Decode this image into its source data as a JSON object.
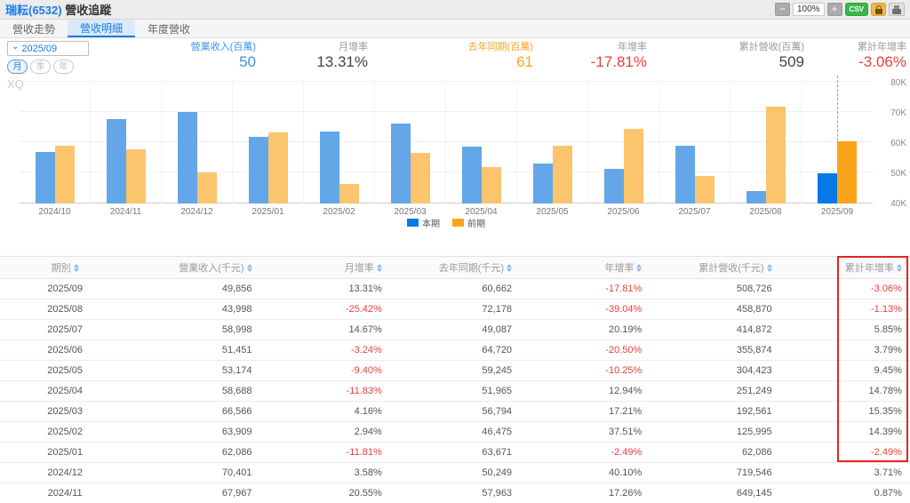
{
  "header": {
    "stock": "瑞耘(6532)",
    "title": "營收追蹤",
    "zoom_out": "−",
    "zoom_level": "100%",
    "zoom_in": "+",
    "csv": "CSV"
  },
  "tabs": [
    {
      "label": "營收走勢",
      "active": false
    },
    {
      "label": "營收明細",
      "active": true
    },
    {
      "label": "年度營收",
      "active": false
    }
  ],
  "controls": {
    "date": "2025/09",
    "period_buttons": [
      {
        "label": "月",
        "active": true
      },
      {
        "label": "季",
        "active": false
      },
      {
        "label": "年",
        "active": false
      }
    ]
  },
  "stats": [
    {
      "label": "營業收入(百萬)",
      "value": "50",
      "label_color": "#3c94ea",
      "value_color": "#3c94ea"
    },
    {
      "label": "月增率",
      "value": "13.31%",
      "label_color": "#999999",
      "value_color": "#444444"
    },
    {
      "label": "去年同期(百萬)",
      "value": "61",
      "label_color": "#f5a623",
      "value_color": "#f5a623"
    },
    {
      "label": "年增率",
      "value": "-17.81%",
      "label_color": "#999999",
      "value_color": "#e8403a"
    },
    {
      "label": "累計營收(百萬)",
      "value": "509",
      "label_color": "#999999",
      "value_color": "#444444"
    },
    {
      "label": "累計年增率",
      "value": "-3.06%",
      "label_color": "#999999",
      "value_color": "#e8403a"
    }
  ],
  "chart_data": {
    "type": "bar",
    "watermark": "XQ",
    "categories": [
      "2024/10",
      "2024/11",
      "2024/12",
      "2025/01",
      "2025/02",
      "2025/03",
      "2025/04",
      "2025/05",
      "2025/06",
      "2025/07",
      "2025/08",
      "2025/09"
    ],
    "series": [
      {
        "name": "本期",
        "color": "#63a7e8",
        "highlight_color": "#0878e8",
        "values": [
          57.0,
          67.97,
          70.4,
          62.09,
          63.91,
          66.57,
          58.69,
          53.17,
          51.45,
          59.0,
          44.0,
          49.86
        ]
      },
      {
        "name": "前期",
        "color": "#fbc46d",
        "highlight_color": "#faa41b",
        "values": [
          59.0,
          57.96,
          50.25,
          63.67,
          46.48,
          56.79,
          51.97,
          59.25,
          64.72,
          49.09,
          72.18,
          60.66
        ]
      }
    ],
    "unit": "千元 (thousands, axis in K)",
    "ylim": [
      40,
      82
    ],
    "yticks": [
      "80K",
      "70K",
      "60K",
      "50K",
      "40K"
    ],
    "highlight_index": 11,
    "legend": [
      "本期",
      "前期"
    ],
    "legend_position": "bottom-center",
    "grid": true
  },
  "table": {
    "columns": [
      "期別",
      "營業收入(千元)",
      "月增率",
      "去年同期(千元)",
      "年增率",
      "累計營收(千元)",
      "累計年增率"
    ],
    "rows": [
      [
        "2025/09",
        "49,856",
        "13.31%",
        "60,662",
        "-17.81%",
        "508,726",
        "-3.06%"
      ],
      [
        "2025/08",
        "43,998",
        "-25.42%",
        "72,178",
        "-39.04%",
        "458,870",
        "-1.13%"
      ],
      [
        "2025/07",
        "58,998",
        "14.67%",
        "49,087",
        "20.19%",
        "414,872",
        "5.85%"
      ],
      [
        "2025/06",
        "51,451",
        "-3.24%",
        "64,720",
        "-20.50%",
        "355,874",
        "3.79%"
      ],
      [
        "2025/05",
        "53,174",
        "-9.40%",
        "59,245",
        "-10.25%",
        "304,423",
        "9.45%"
      ],
      [
        "2025/04",
        "58,688",
        "-11.83%",
        "51,965",
        "12.94%",
        "251,249",
        "14.78%"
      ],
      [
        "2025/03",
        "66,566",
        "4.16%",
        "56,794",
        "17.21%",
        "192,561",
        "15.35%"
      ],
      [
        "2025/02",
        "63,909",
        "2.94%",
        "46,475",
        "37.51%",
        "125,995",
        "14.39%"
      ],
      [
        "2025/01",
        "62,086",
        "-11.81%",
        "63,671",
        "-2.49%",
        "62,086",
        "-2.49%"
      ],
      [
        "2024/12",
        "70,401",
        "3.58%",
        "50,249",
        "40.10%",
        "719,546",
        "3.71%"
      ],
      [
        "2024/11",
        "67,967",
        "20.55%",
        "57,963",
        "17.26%",
        "649,145",
        "0.87%"
      ]
    ],
    "highlight": {
      "column": "累計年增率",
      "rows_covered": [
        "2025/09",
        "2025/01"
      ],
      "color": "#e62222"
    }
  }
}
